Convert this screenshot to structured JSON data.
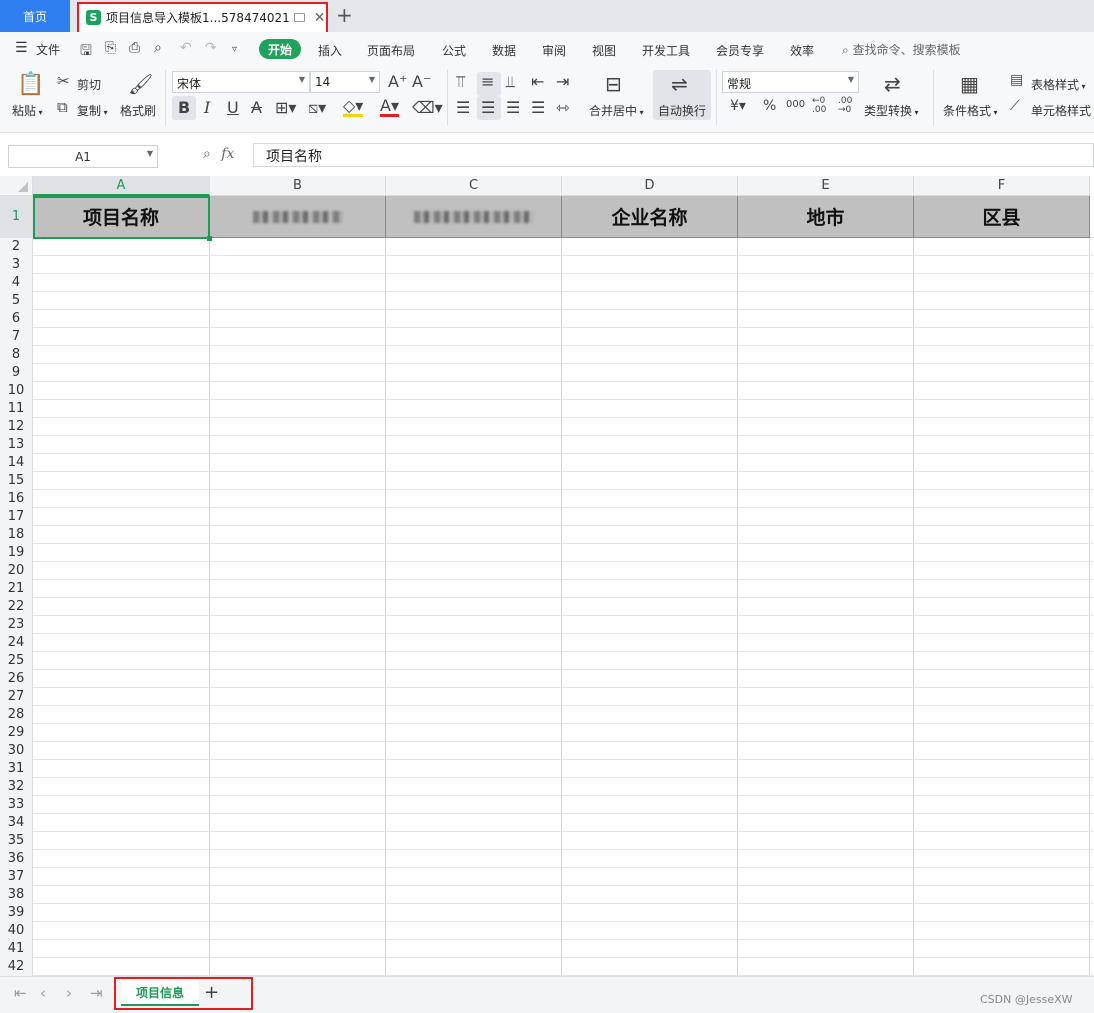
{
  "titlebar": {
    "home_tab": "首页",
    "doc_icon": "S",
    "doc_title": "项目信息导入模板1...578474021",
    "new_tab": "+"
  },
  "menubar": {
    "file": "文件",
    "tabs": [
      "开始",
      "插入",
      "页面布局",
      "公式",
      "数据",
      "审阅",
      "视图",
      "开发工具",
      "会员专享",
      "效率"
    ],
    "search": "查找命令、搜索模板"
  },
  "ribbon": {
    "paste": "粘贴",
    "cut": "剪切",
    "copy": "复制",
    "format_painter": "格式刷",
    "font_name": "宋体",
    "font_size": "14",
    "merge_center": "合并居中",
    "wrap_text": "自动换行",
    "number_format": "常规",
    "type_convert": "类型转换",
    "conditional_format": "条件格式",
    "table_style": "表格样式",
    "cell_style": "单元格样式"
  },
  "formula": {
    "cell_ref": "A1",
    "fx": "fx",
    "value": "项目名称"
  },
  "sheet": {
    "columns": [
      "A",
      "B",
      "C",
      "D",
      "E",
      "F"
    ],
    "headers": [
      "项目名称",
      "",
      "",
      "企业名称",
      "地市",
      "区县"
    ],
    "row_numbers": [
      "1",
      "2",
      "3",
      "4",
      "5",
      "6",
      "7",
      "8",
      "9",
      "10",
      "11",
      "12",
      "13",
      "14",
      "15",
      "16",
      "17",
      "18",
      "19",
      "20",
      "21",
      "22",
      "23",
      "24",
      "25",
      "26",
      "27",
      "28",
      "29",
      "30",
      "31",
      "32",
      "33",
      "34",
      "35",
      "36",
      "37",
      "38",
      "39",
      "40",
      "41",
      "42"
    ]
  },
  "sheetbar": {
    "active_sheet": "项目信息",
    "add": "+",
    "watermark": "CSDN @JesseXW"
  },
  "colors": {
    "accent_green": "#1f9b55",
    "home_blue": "#2f7ff0",
    "highlight_red": "#e02020",
    "header_fill": "#c0c0c0"
  }
}
